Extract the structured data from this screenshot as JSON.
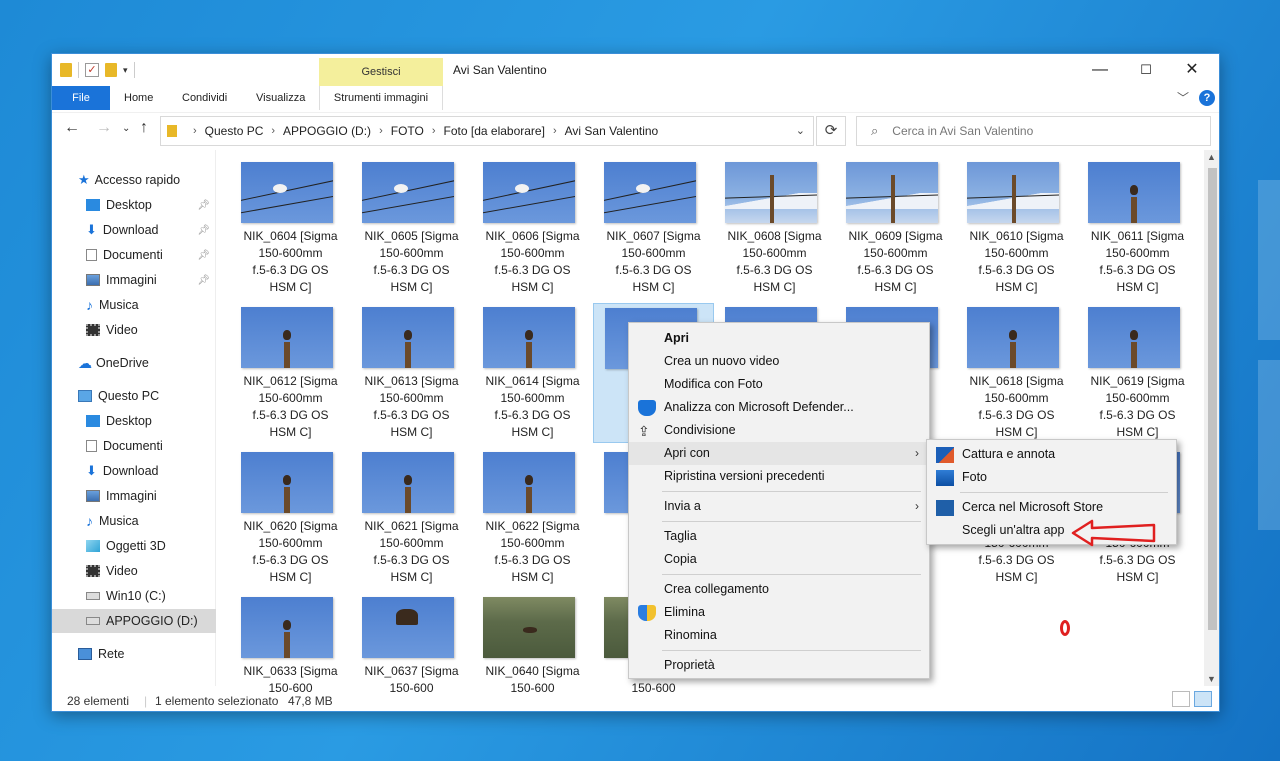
{
  "window": {
    "title": "Avi San Valentino",
    "context_tab_header": "Gestisci",
    "minimize": "—",
    "maximize": "☐",
    "close": "✕"
  },
  "ribbon": {
    "tabs": [
      "File",
      "Home",
      "Condividi",
      "Visualizza",
      "Strumenti immagini"
    ],
    "help": "?"
  },
  "address": {
    "crumbs": [
      "Questo PC",
      "APPOGGIO (D:)",
      "FOTO",
      "Foto [da elaborare]",
      "Avi San Valentino"
    ],
    "search_placeholder": "Cerca in Avi San Valentino"
  },
  "nav": {
    "quick_access": "Accesso rapido",
    "quick_items": [
      "Desktop",
      "Download",
      "Documenti",
      "Immagini",
      "Musica",
      "Video"
    ],
    "onedrive": "OneDrive",
    "this_pc": "Questo PC",
    "pc_items": [
      "Desktop",
      "Documenti",
      "Download",
      "Immagini",
      "Musica",
      "Oggetti 3D",
      "Video",
      "Win10 (C:)",
      "APPOGGIO (D:)"
    ],
    "network": "Rete"
  },
  "files": [
    {
      "name": "NIK_0604 [Sigma",
      "l2": "150-600mm",
      "l3": "f.5-6.3 DG OS",
      "l4": "HSM C]",
      "kind": "egret"
    },
    {
      "name": "NIK_0605 [Sigma",
      "l2": "150-600mm",
      "l3": "f.5-6.3 DG OS",
      "l4": "HSM C]",
      "kind": "egret"
    },
    {
      "name": "NIK_0606 [Sigma",
      "l2": "150-600mm",
      "l3": "f.5-6.3 DG OS",
      "l4": "HSM C]",
      "kind": "egret"
    },
    {
      "name": "NIK_0607 [Sigma",
      "l2": "150-600mm",
      "l3": "f.5-6.3 DG OS",
      "l4": "HSM C]",
      "kind": "egret"
    },
    {
      "name": "NIK_0608 [Sigma",
      "l2": "150-600mm",
      "l3": "f.5-6.3 DG OS",
      "l4": "HSM C]",
      "kind": "mtn"
    },
    {
      "name": "NIK_0609 [Sigma",
      "l2": "150-600mm",
      "l3": "f.5-6.3 DG OS",
      "l4": "HSM C]",
      "kind": "mtn"
    },
    {
      "name": "NIK_0610 [Sigma",
      "l2": "150-600mm",
      "l3": "f.5-6.3 DG OS",
      "l4": "HSM C]",
      "kind": "mtn"
    },
    {
      "name": "NIK_0611 [Sigma",
      "l2": "150-600mm",
      "l3": "f.5-6.3 DG OS",
      "l4": "HSM C]",
      "kind": "pole"
    },
    {
      "name": "NIK_0612 [Sigma",
      "l2": "150-600mm",
      "l3": "f.5-6.3 DG OS",
      "l4": "HSM C]",
      "kind": "pole"
    },
    {
      "name": "NIK_0613 [Sigma",
      "l2": "150-600mm",
      "l3": "f.5-6.3 DG OS",
      "l4": "HSM C]",
      "kind": "pole"
    },
    {
      "name": "NIK_0614 [Sigma",
      "l2": "150-600mm",
      "l3": "f.5-6.3 DG OS",
      "l4": "HSM C]",
      "kind": "pole"
    },
    {
      "name": "NIK_",
      "l2": "15",
      "l3": "f.5",
      "l4": "",
      "kind": "pole"
    },
    {
      "name": "",
      "l2": "",
      "l3": "",
      "l4": "",
      "kind": "pole"
    },
    {
      "name": "",
      "l2": "",
      "l3": "",
      "l4": "",
      "kind": "pole"
    },
    {
      "name": "NIK_0618 [Sigma",
      "l2": "150-600mm",
      "l3": "f.5-6.3 DG OS",
      "l4": "HSM C]",
      "kind": "pole"
    },
    {
      "name": "NIK_0619 [Sigma",
      "l2": "150-600mm",
      "l3": "f.5-6.3 DG OS",
      "l4": "HSM C]",
      "kind": "pole"
    },
    {
      "name": "NIK_0620 [Sigma",
      "l2": "150-600mm",
      "l3": "f.5-6.3 DG OS",
      "l4": "HSM C]",
      "kind": "pole"
    },
    {
      "name": "NIK_0621 [Sigma",
      "l2": "150-600mm",
      "l3": "f.5-6.3 DG OS",
      "l4": "HSM C]",
      "kind": "pole"
    },
    {
      "name": "NIK_0622 [Sigma",
      "l2": "150-600mm",
      "l3": "f.5-6.3 DG OS",
      "l4": "HSM C]",
      "kind": "pole"
    },
    {
      "name": "NIK_",
      "l2": "15",
      "l3": "",
      "l4": "",
      "kind": "pole"
    },
    {
      "name": "",
      "l2": "",
      "l3": "",
      "l4": "",
      "kind": "pole"
    },
    {
      "name": "",
      "l2": "",
      "l3": "",
      "l4": "",
      "kind": "pole"
    },
    {
      "name": "",
      "l2": "150-600mm",
      "l3": "f.5-6.3 DG OS",
      "l4": "HSM C]",
      "kind": "pole"
    },
    {
      "name": "",
      "l2": "150-600mm",
      "l3": "f.5-6.3 DG OS",
      "l4": "HSM C]",
      "kind": "pole"
    },
    {
      "name": "NIK_0633 [Sigma",
      "l2": "150-600",
      "l3": "",
      "l4": "",
      "kind": "pole"
    },
    {
      "name": "NIK_0637 [Sigma",
      "l2": "150-600",
      "l3": "",
      "l4": "",
      "kind": "flying"
    },
    {
      "name": "NIK_0640 [Sigma",
      "l2": "150-600",
      "l3": "",
      "l4": "",
      "kind": "pond"
    },
    {
      "name": "NIK_",
      "l2": "150-600",
      "l3": "",
      "l4": "",
      "kind": "pond"
    }
  ],
  "context_menu": {
    "items": [
      "Apri",
      "Crea un nuovo video",
      "Modifica con Foto",
      "Analizza con Microsoft Defender...",
      "Condivisione",
      "Apri con",
      "Ripristina versioni precedenti",
      "Invia a",
      "Taglia",
      "Copia",
      "Crea collegamento",
      "Elimina",
      "Rinomina",
      "Proprietà"
    ]
  },
  "submenu": {
    "items": [
      "Cattura e annota",
      "Foto",
      "Cerca nel Microsoft Store",
      "Scegli un'altra app"
    ]
  },
  "status": {
    "count": "28 elementi",
    "selection": "1 elemento selezionato",
    "size": "47,8 MB"
  },
  "colors": {
    "accent": "#1a73d9",
    "context_tab": "#f4ef9c",
    "annotation": "#e02020"
  }
}
